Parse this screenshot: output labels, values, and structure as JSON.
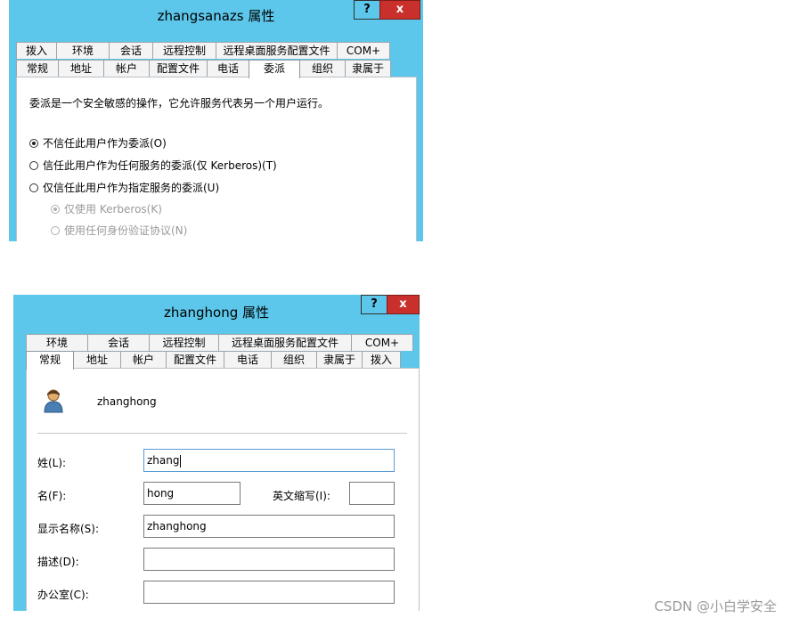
{
  "dialog1": {
    "title": "zhangsanazs 属性",
    "help_label": "?",
    "close_label": "x",
    "tabs_row1": [
      "拨入",
      "环境",
      "会话",
      "远程控制",
      "远程桌面服务配置文件",
      "COM+"
    ],
    "tabs_row2": [
      "常规",
      "地址",
      "帐户",
      "配置文件",
      "电话",
      "委派",
      "组织",
      "隶属于"
    ],
    "active_tab": "委派",
    "description": "委派是一个安全敏感的操作，它允许服务代表另一个用户运行。",
    "options": [
      {
        "label": "不信任此用户作为委派(O)",
        "selected": true,
        "disabled": false
      },
      {
        "label": "信任此用户作为任何服务的委派(仅 Kerberos)(T)",
        "selected": false,
        "disabled": false
      },
      {
        "label": "仅信任此用户作为指定服务的委派(U)",
        "selected": false,
        "disabled": false
      },
      {
        "label": "仅使用 Kerberos(K)",
        "selected": true,
        "disabled": true
      },
      {
        "label": "使用任何身份验证协议(N)",
        "selected": false,
        "disabled": true
      }
    ]
  },
  "dialog2": {
    "title": "zhanghong 属性",
    "help_label": "?",
    "close_label": "x",
    "tabs_row1": [
      "环境",
      "会话",
      "远程控制",
      "远程桌面服务配置文件",
      "COM+"
    ],
    "tabs_row2": [
      "常规",
      "地址",
      "帐户",
      "配置文件",
      "电话",
      "组织",
      "隶属于",
      "拨入"
    ],
    "active_tab": "常规",
    "username": "zhanghong",
    "icon": "user-icon",
    "fields": {
      "last_name_label": "姓(L):",
      "last_name_value": "zhang",
      "first_name_label": "名(F):",
      "first_name_value": "hong",
      "initials_label": "英文缩写(I):",
      "initials_value": "",
      "display_name_label": "显示名称(S):",
      "display_name_value": "zhanghong",
      "description_label": "描述(D):",
      "description_value": "",
      "office_label": "办公室(C):",
      "office_value": ""
    }
  },
  "watermark": "CSDN @小白学安全",
  "colors": {
    "titlebar": "#5cc7ea",
    "close": "#c9302c"
  }
}
